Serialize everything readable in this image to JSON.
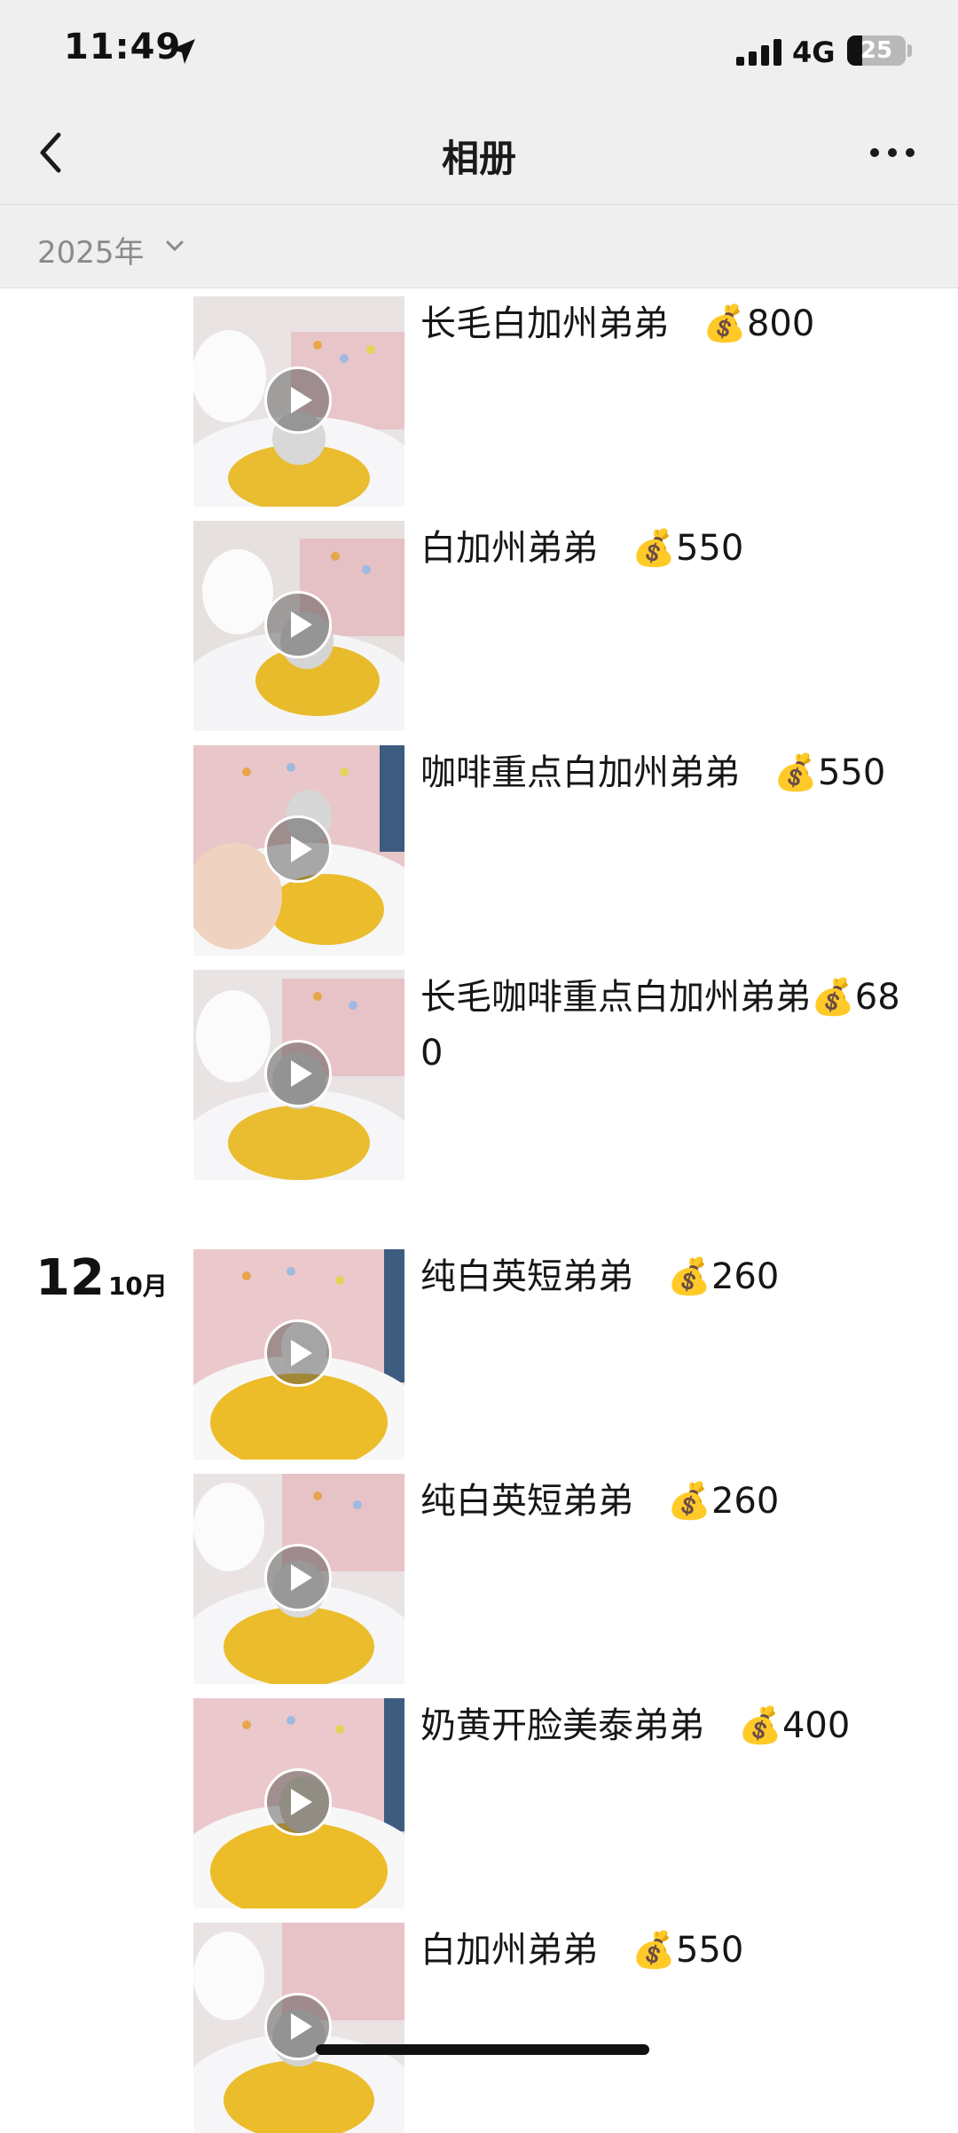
{
  "status_bar": {
    "time": "11:49",
    "network": "4G",
    "battery": "25"
  },
  "nav": {
    "title": "相册"
  },
  "filter": {
    "year": "2025年"
  },
  "groups": [
    {
      "date_day": "",
      "date_month": "",
      "items": [
        {
          "caption": "长毛白加州弟弟   💰800"
        },
        {
          "caption": "白加州弟弟   💰550"
        },
        {
          "caption": "咖啡重点白加州弟弟   💰550"
        },
        {
          "caption": "长毛咖啡重点白加州弟弟💰680"
        }
      ]
    },
    {
      "date_day": "12",
      "date_month": "10月",
      "items": [
        {
          "caption": "纯白英短弟弟   💰260"
        },
        {
          "caption": "纯白英短弟弟   💰260"
        },
        {
          "caption": "奶黄开脸美泰弟弟   💰400"
        },
        {
          "caption": "白加州弟弟   💰550"
        }
      ]
    }
  ],
  "icons": {
    "play": "play-icon",
    "money_bag": "money-bag-emoji"
  }
}
